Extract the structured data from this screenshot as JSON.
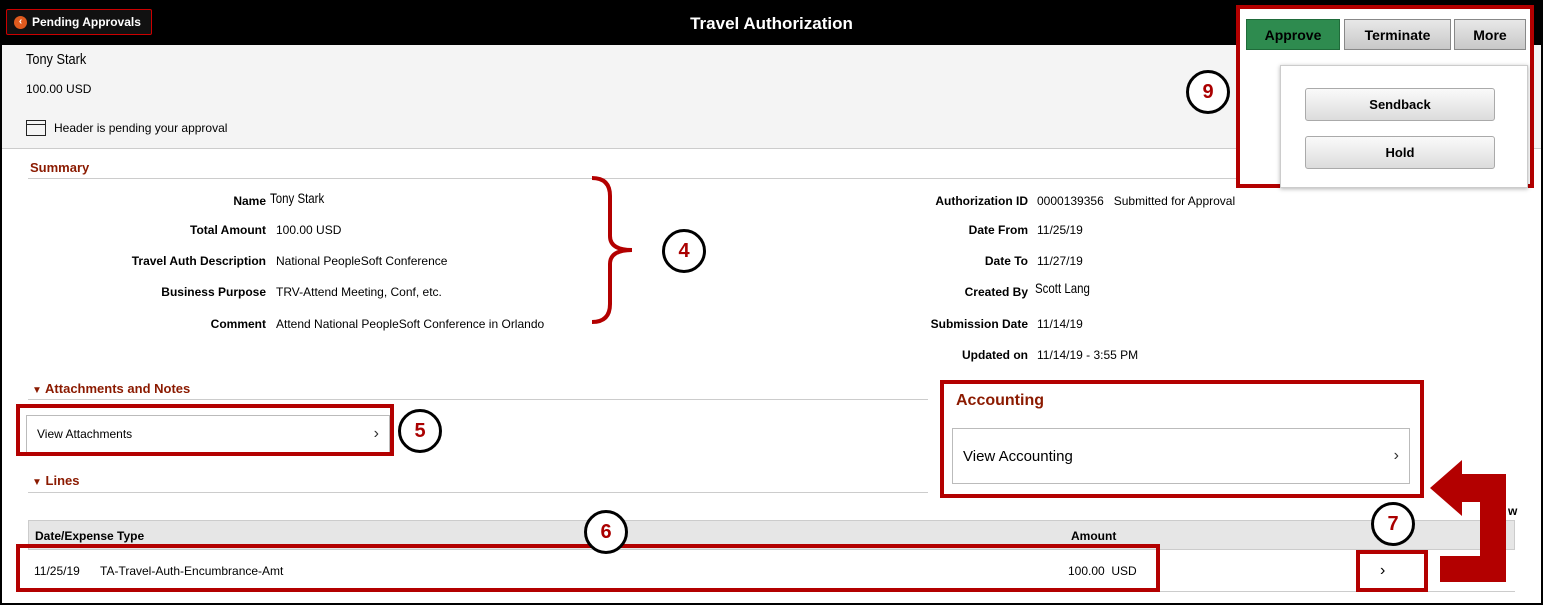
{
  "banner": {
    "back_label": "Pending Approvals",
    "title": "Travel Authorization"
  },
  "actions": {
    "approve": "Approve",
    "terminate": "Terminate",
    "more": "More",
    "menu": [
      "Sendback",
      "Hold"
    ]
  },
  "header": {
    "name": "Tony Stark",
    "amount": "100.00  USD",
    "status": "Header is pending your approval"
  },
  "summary": {
    "heading": "Summary",
    "left": [
      {
        "label": "Name",
        "value": "Tony Stark"
      },
      {
        "label": "Total Amount",
        "value": "100.00  USD"
      },
      {
        "label": "Travel Auth Description",
        "value": "National PeopleSoft Conference"
      },
      {
        "label": "Business Purpose",
        "value": "TRV-Attend Meeting, Conf, etc."
      },
      {
        "label": "Comment",
        "value": "Attend National PeopleSoft Conference in Orlando"
      }
    ],
    "right": [
      {
        "label": "Authorization ID",
        "value": "0000139356   Submitted for Approval"
      },
      {
        "label": "Date From",
        "value": "11/25/19"
      },
      {
        "label": "Date To",
        "value": "11/27/19"
      },
      {
        "label": "Created By",
        "value": "Scott Lang"
      },
      {
        "label": "Submission Date",
        "value": "11/14/19"
      },
      {
        "label": "Updated on",
        "value": "11/14/19 - 3:55 PM"
      }
    ]
  },
  "attachments": {
    "heading": "Attachments and Notes",
    "view_label": "View Attachments"
  },
  "accounting": {
    "heading": "Accounting",
    "view_label": "View Accounting"
  },
  "lines": {
    "heading": "Lines",
    "columns": [
      "Date/Expense Type",
      "Amount"
    ],
    "rows": [
      {
        "date": "11/25/19",
        "type": "TA-Travel-Auth-Encumbrance-Amt",
        "amount": "100.00  USD"
      }
    ]
  },
  "callouts": [
    "4",
    "5",
    "6",
    "7",
    "9"
  ],
  "colors": {
    "annotation_red": "#b30000",
    "section_heading": "#8b1a00",
    "approve_green": "#2e8b4f"
  }
}
